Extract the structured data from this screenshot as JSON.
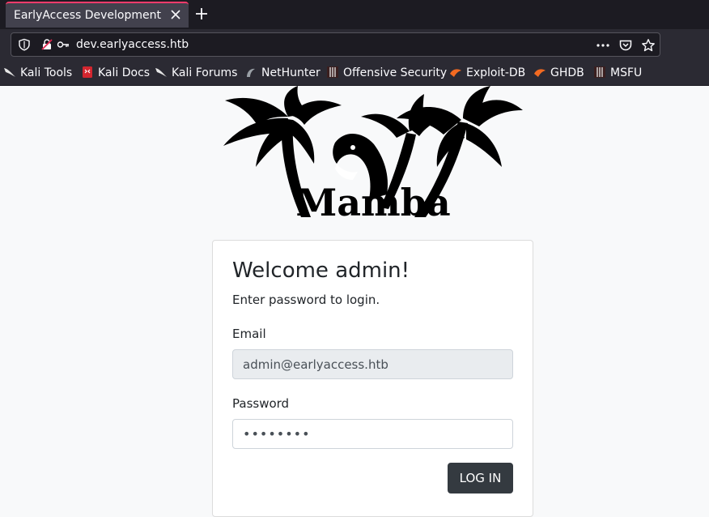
{
  "browser": {
    "tab": {
      "title": "EarlyAccess Development"
    },
    "url": "dev.earlyaccess.htb",
    "bookmarks": [
      {
        "label": "Kali Tools",
        "icon": "kali-dragon-icon"
      },
      {
        "label": "Kali Docs",
        "icon": "kali-docs-icon"
      },
      {
        "label": "Kali Forums",
        "icon": "kali-dragon-icon"
      },
      {
        "label": "NetHunter",
        "icon": "nethunter-icon"
      },
      {
        "label": "Offensive Security",
        "icon": "offsec-icon"
      },
      {
        "label": "Exploit-DB",
        "icon": "exploitdb-icon"
      },
      {
        "label": "GHDB",
        "icon": "exploitdb-icon"
      },
      {
        "label": "MSFU",
        "icon": "offsec-icon"
      }
    ]
  },
  "logo": {
    "text": "Mamba"
  },
  "login": {
    "title": "Welcome admin!",
    "subtitle": "Enter password to login.",
    "email_label": "Email",
    "email_value": "admin@earlyaccess.htb",
    "password_label": "Password",
    "password_value": "••••••••",
    "button_label": "LOG IN"
  },
  "colors": {
    "tab_accent": "#ff3b6b",
    "button_bg": "#343a40",
    "page_bg": "#f8f9fa"
  }
}
